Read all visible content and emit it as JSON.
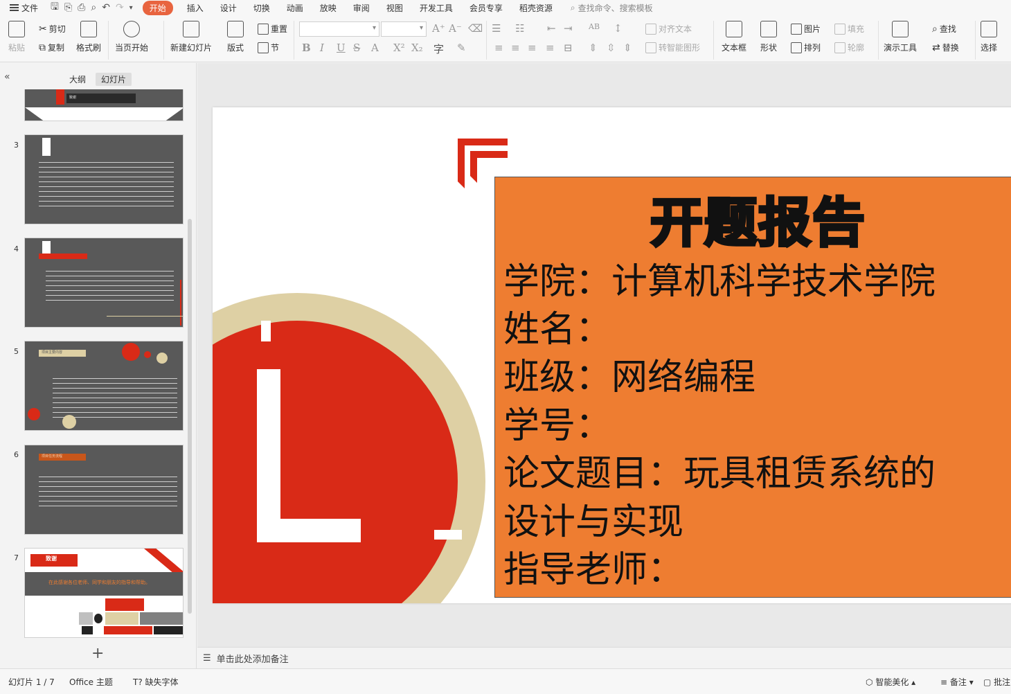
{
  "menu": {
    "file": "文件",
    "tabs": [
      "开始",
      "插入",
      "设计",
      "切换",
      "动画",
      "放映",
      "审阅",
      "视图",
      "开发工具",
      "会员专享",
      "稻壳资源"
    ],
    "active_tab": "开始",
    "search": "查找命令、搜索模板"
  },
  "ribbon": {
    "paste": "粘贴",
    "cut": "剪切",
    "copy": "复制",
    "format_painter": "格式刷",
    "from_current": "当页开始",
    "new_slide": "新建幻灯片",
    "layout": "版式",
    "reset": "重置",
    "section": "节",
    "align_text": "对齐文本",
    "to_smartart": "转智能图形",
    "textbox": "文本框",
    "shape": "形状",
    "picture": "图片",
    "arrange": "排列",
    "fill": "填充",
    "outline": "轮廓",
    "present_tools": "演示工具",
    "find": "查找",
    "replace": "替换",
    "select": "选择"
  },
  "left_pane": {
    "tab_outline": "大纲",
    "tab_slides": "幻灯片",
    "thumbs": [
      {
        "num": "3"
      },
      {
        "num": "4"
      },
      {
        "num": "5",
        "label": "项目主要内容"
      },
      {
        "num": "6",
        "label": "项目任务流程"
      },
      {
        "num": "7",
        "label": "致谢",
        "text": "在此感谢各位老师、同学和朋友的指导和帮助。"
      }
    ],
    "thumb2_label": "致谢"
  },
  "slide": {
    "title": "开题报告",
    "lines": [
      "学院：计算机科学技术学院",
      "姓名：",
      "班级：网络编程",
      "学号：",
      "论文题目：玩具租赁系统的",
      "设计与实现",
      "指导老师："
    ]
  },
  "notes": {
    "placeholder": "单击此处添加备注"
  },
  "status": {
    "slide_info": "幻灯片 1 / 7",
    "theme": "Office 主题",
    "missing_font": "缺失字体",
    "beautify": "智能美化",
    "notes": "备注",
    "comments": "批注"
  },
  "colors": {
    "accent": "#e8643f",
    "slide_orange": "#ee7d31",
    "slide_red": "#d92a17",
    "ring": "#ded0a4"
  }
}
